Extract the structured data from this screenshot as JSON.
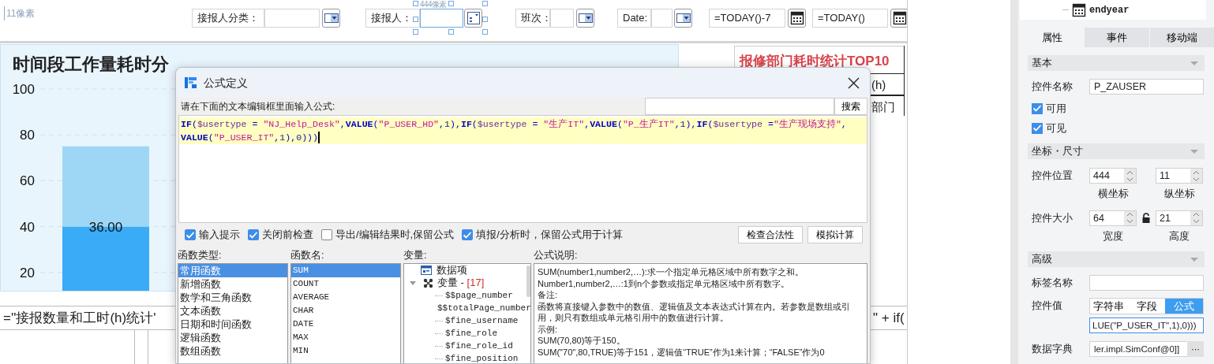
{
  "canvas": {
    "margin_label": "11像素",
    "selection_label": "444像素",
    "parameters": [
      {
        "kind": "dropdown",
        "label": "接报人分类：",
        "selected": false
      },
      {
        "kind": "list",
        "label": "接报人：",
        "selected": true
      },
      {
        "kind": "dropdown",
        "label": "班次：",
        "selected": false
      },
      {
        "kind": "dropdown",
        "label": "Date:",
        "selected": false
      },
      {
        "kind": "date",
        "value": "=TODAY()-7",
        "selected": false
      },
      {
        "kind": "date",
        "value": "=TODAY()",
        "selected": false
      }
    ],
    "chart": {
      "chart_data": {
        "type": "bar",
        "title": "时间段工作量耗时分",
        "stacked": true,
        "grid": true,
        "ylim": [
          12,
          100
        ],
        "yticks": [
          20,
          40,
          60,
          80,
          100
        ],
        "series": [
          {
            "color": "#3aabf7",
            "values": [
              40
            ]
          },
          {
            "color": "#9dd7f5",
            "values": [
              35
            ]
          }
        ],
        "value_labels": [
          "36.00"
        ]
      }
    },
    "report_table": {
      "title": "报修部门耗时统计TOP10",
      "cells": [
        "(h)",
        "部门"
      ]
    },
    "formula_row": {
      "left": "=''接报数量和工时(h)统计'",
      "right": "\" + if("
    }
  },
  "dialog": {
    "title": "公式定义",
    "prompt": "请在下面的文本编辑框里面输入公式:",
    "search_button": "搜索",
    "formula_lines": [
      [
        {
          "kind": "function",
          "text": "IF"
        },
        {
          "kind": "punct",
          "text": "("
        },
        {
          "kind": "variable",
          "text": "$usertype"
        },
        {
          "kind": "punct",
          "text": " = "
        },
        {
          "kind": "string",
          "text": "\"NJ_Help_Desk\""
        },
        {
          "kind": "punct",
          "text": ","
        },
        {
          "kind": "function",
          "text": "VALUE"
        },
        {
          "kind": "punct",
          "text": "("
        },
        {
          "kind": "string",
          "text": "\"P_USER_HD\""
        },
        {
          "kind": "punct",
          "text": ","
        },
        {
          "kind": "number",
          "text": "1"
        },
        {
          "kind": "punct",
          "text": "),"
        },
        {
          "kind": "function",
          "text": "IF"
        },
        {
          "kind": "punct",
          "text": "("
        },
        {
          "kind": "variable",
          "text": "$usertype"
        },
        {
          "kind": "punct",
          "text": " = "
        },
        {
          "kind": "string",
          "text": "\"生产IT\""
        },
        {
          "kind": "punct",
          "text": ","
        },
        {
          "kind": "function",
          "text": "VALUE"
        },
        {
          "kind": "punct",
          "text": "("
        },
        {
          "kind": "string",
          "text": "\"P_生产IT\""
        },
        {
          "kind": "punct",
          "text": ","
        },
        {
          "kind": "number",
          "text": "1"
        },
        {
          "kind": "punct",
          "text": "),"
        },
        {
          "kind": "function",
          "text": "IF"
        },
        {
          "kind": "punct",
          "text": "("
        },
        {
          "kind": "variable",
          "text": "$usertype"
        },
        {
          "kind": "punct",
          "text": " ="
        },
        {
          "kind": "string",
          "text": "\"生产现场支持\""
        },
        {
          "kind": "punct",
          "text": ","
        }
      ],
      [
        {
          "kind": "function",
          "text": "VALUE"
        },
        {
          "kind": "punct",
          "text": "("
        },
        {
          "kind": "string",
          "text": "\"P_USER_IT\""
        },
        {
          "kind": "punct",
          "text": ","
        },
        {
          "kind": "number",
          "text": "1"
        },
        {
          "kind": "punct",
          "text": "),"
        },
        {
          "kind": "number",
          "text": "0"
        },
        {
          "kind": "punct",
          "text": ")))"
        }
      ]
    ],
    "options": [
      {
        "label": "输入提示",
        "checked": true
      },
      {
        "label": "关闭前检查",
        "checked": true
      },
      {
        "label": "导出/编辑结果时,保留公式",
        "checked": false
      },
      {
        "label": "填报/分析时，保留公式用于计算",
        "checked": true
      }
    ],
    "buttons": [
      "检查合法性",
      "模拟计算"
    ],
    "function_types": {
      "label": "函数类型:",
      "items": [
        {
          "text": "常用函数",
          "selected": true
        },
        {
          "text": "新增函数",
          "selected": false
        },
        {
          "text": "数学和三角函数",
          "selected": false
        },
        {
          "text": "文本函数",
          "selected": false
        },
        {
          "text": "日期和时间函数",
          "selected": false
        },
        {
          "text": "逻辑函数",
          "selected": false
        },
        {
          "text": "数组函数",
          "selected": false
        }
      ]
    },
    "function_names": {
      "label": "函数名:",
      "items": [
        {
          "text": "SUM",
          "selected": true
        },
        {
          "text": "COUNT",
          "selected": false
        },
        {
          "text": "AVERAGE",
          "selected": false
        },
        {
          "text": "CHAR",
          "selected": false
        },
        {
          "text": "DATE",
          "selected": false
        },
        {
          "text": "MAX",
          "selected": false
        },
        {
          "text": "MIN",
          "selected": false
        }
      ]
    },
    "variables": {
      "label": "变量:",
      "items": [
        {
          "kind": "data",
          "text": "数据项"
        },
        {
          "kind": "group",
          "text": "变量 - ",
          "count": "[17]",
          "expanded": true,
          "children": [
            "$$page_number",
            "$$totalPage_number",
            "$fine_username",
            "$fine_role",
            "$fine_role_id",
            "$fine_position"
          ]
        }
      ]
    },
    "description": {
      "label": "公式说明:",
      "lines": [
        "SUM(number1,number2,…):求一个指定单元格区域中所有数字之和。",
        "Number1,number2,…:1到n个参数或指定单元格区域中所有数字。",
        "备注:",
        "函数将直接键入参数中的数值、逻辑值及文本表达式计算在内。若参数是数组或引用，则只有数组或单元格引用中的数值进行计算。",
        "示例:",
        "SUM(70,80)等于150。",
        "SUM(\"70\",80,TRUE)等于151，逻辑值“TRUE”作为1来计算；“FALSE”作为0"
      ]
    }
  },
  "properties_panel": {
    "tree_item": "endyear",
    "tabs": [
      {
        "label": "属性",
        "selected": true
      },
      {
        "label": "事件",
        "selected": false
      },
      {
        "label": "移动端",
        "selected": false
      }
    ],
    "sections": [
      {
        "title": "基本",
        "rows": [
          {
            "kind": "text",
            "label": "控件名称",
            "value": "P_ZAUSER"
          },
          {
            "kind": "check",
            "label": "可用",
            "checked": true
          },
          {
            "kind": "check",
            "label": "可见",
            "checked": true
          }
        ]
      },
      {
        "title": "坐标・尺寸",
        "rows": [
          {
            "kind": "pair",
            "label": "控件位置",
            "fields": [
              {
                "value": "444",
                "caption": "横坐标"
              },
              {
                "value": "11",
                "caption": "纵坐标"
              }
            ]
          },
          {
            "kind": "pair",
            "label": "控件大小",
            "locked": false,
            "fields": [
              {
                "value": "64",
                "caption": "宽度"
              },
              {
                "value": "21",
                "caption": "高度"
              }
            ]
          }
        ]
      },
      {
        "title": "高级",
        "rows": [
          {
            "kind": "text",
            "label": "标签名称"
          },
          {
            "kind": "value",
            "label": "控件值",
            "modes": [
              {
                "label": "字符串",
                "selected": false
              },
              {
                "label": "字段",
                "selected": false
              },
              {
                "label": "公式",
                "selected": true
              }
            ],
            "value": "LUE(\"P_USER_IT\",1),0)))"
          },
          {
            "kind": "dict",
            "label": "数据字典",
            "value": "ler.impl.SimConf@0]]",
            "button": "···"
          }
        ]
      }
    ]
  }
}
